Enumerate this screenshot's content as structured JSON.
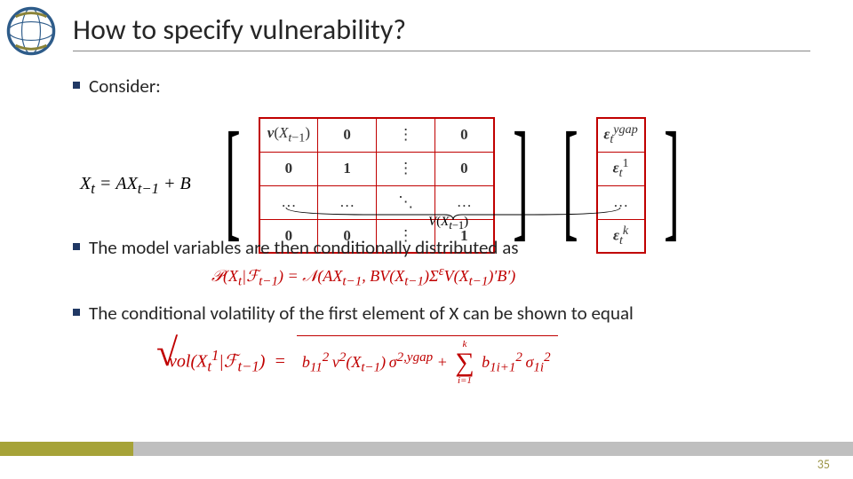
{
  "title": "How to specify vulnerability?",
  "bullets": {
    "consider": "Consider:",
    "model": "The model variables are then conditionally distributed as",
    "cond": "The conditional volatility of the first element of X can be shown to equal"
  },
  "eq_left_html": "X<sub>t</sub>&nbsp;=&nbsp;AX<sub>t−1</sub> + B",
  "matrix_main": [
    [
      "<span class='ital bold'>v</span>(<span class='ital'>X</span><sub><span class='ital'>t</span>−1</sub>)",
      "<span class='bold'>0</span>",
      "⋮",
      "<span class='bold'>0</span>"
    ],
    [
      "<span class='bold'>0</span>",
      "<span class='bold'>1</span>",
      "⋮",
      "<span class='bold'>0</span>"
    ],
    [
      "…",
      "…",
      "⋱",
      "…"
    ],
    [
      "<span class='bold'>0</span>",
      "<span class='bold'>0</span>",
      "⋮",
      "<span class='bold'>1</span>"
    ]
  ],
  "matrix_vec": [
    "<span class='ital bold'>ε</span><sub class='ital'>t</sub><sup class='ital'>ygap</sup>",
    "<span class='ital bold'>ε</span><sub class='ital'>t</sub><sup>1</sup>",
    "…",
    "<span class='ital bold'>ε</span><sub class='ital'>t</sub><sup class='ital'>k</sup>"
  ],
  "vlabel_html": "<span class='ital'>V</span>(<span class='ital'>X</span><sub><span class='ital'>t</span>−1</sub>)",
  "eq2_html": "𝒫(X<sub>t</sub>|ℱ<sub>t−1</sub>)&nbsp;=&nbsp;𝒩(AX<sub>t−1</sub>, BV(X<sub>t−1</sub>)Σ<sup>ε</sup>V(X<sub>t−1</sub>)′B′)",
  "eq3_lhs_html": "<span class='ital'>vol</span>(X<sub>t</sub><sup>1</sup>|ℱ<sub>t−1</sub>)&nbsp;&nbsp;=&nbsp;&nbsp;",
  "eq3_rhs_html": "b<sub>11</sub><sup>2</sup>&thinsp;v<sup>2</sup>(X<sub>t−1</sub>)&thinsp;σ<sup>2,ygap</sup>&nbsp;+&nbsp;",
  "eq3_sum_top": "k",
  "eq3_sum_bot": "i=1",
  "eq3_tail_html": "&nbsp;b<sub>1i+1</sub><sup>2</sup>&thinsp;σ<sub>1i</sub><sup>2</sup>",
  "page_number": "35"
}
